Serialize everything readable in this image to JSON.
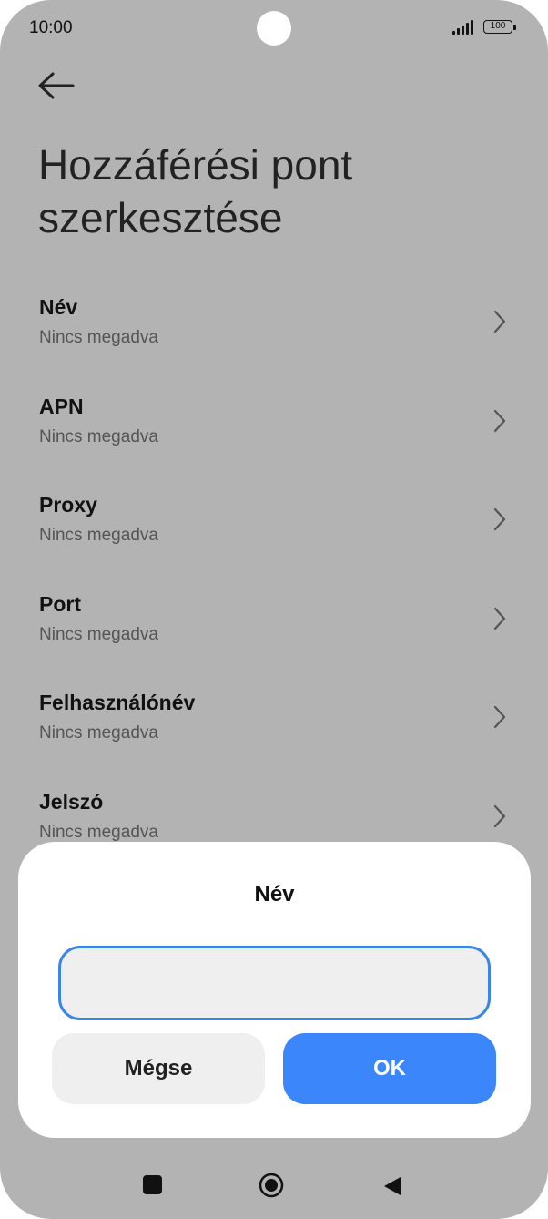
{
  "status_bar": {
    "time": "10:00",
    "battery_level": "100",
    "icons": [
      "camera-cutout",
      "signal-icon",
      "battery-icon"
    ]
  },
  "header": {
    "back_icon": "arrow-left-icon",
    "title": "Hozzáférési pont szerkesztése"
  },
  "settings": {
    "items": [
      {
        "label": "Név",
        "value": "Nincs megadva"
      },
      {
        "label": "APN",
        "value": "Nincs megadva"
      },
      {
        "label": "Proxy",
        "value": "Nincs megadva"
      },
      {
        "label": "Port",
        "value": "Nincs megadva"
      },
      {
        "label": "Felhasználónév",
        "value": "Nincs megadva"
      },
      {
        "label": "Jelszó",
        "value": "Nincs megadva"
      }
    ],
    "chevron_icon": "chevron-right-icon"
  },
  "dialog": {
    "title": "Név",
    "input_value": "",
    "cancel_label": "Mégse",
    "ok_label": "OK"
  },
  "navbar": {
    "icons": [
      "recent-apps-icon",
      "home-icon",
      "back-icon"
    ]
  },
  "colors": {
    "accent": "#3a86fa",
    "input_border": "#3a86e8",
    "overlay_background": "#b3b3b3",
    "dialog_background": "#ffffff",
    "secondary_button": "#efeff0"
  }
}
